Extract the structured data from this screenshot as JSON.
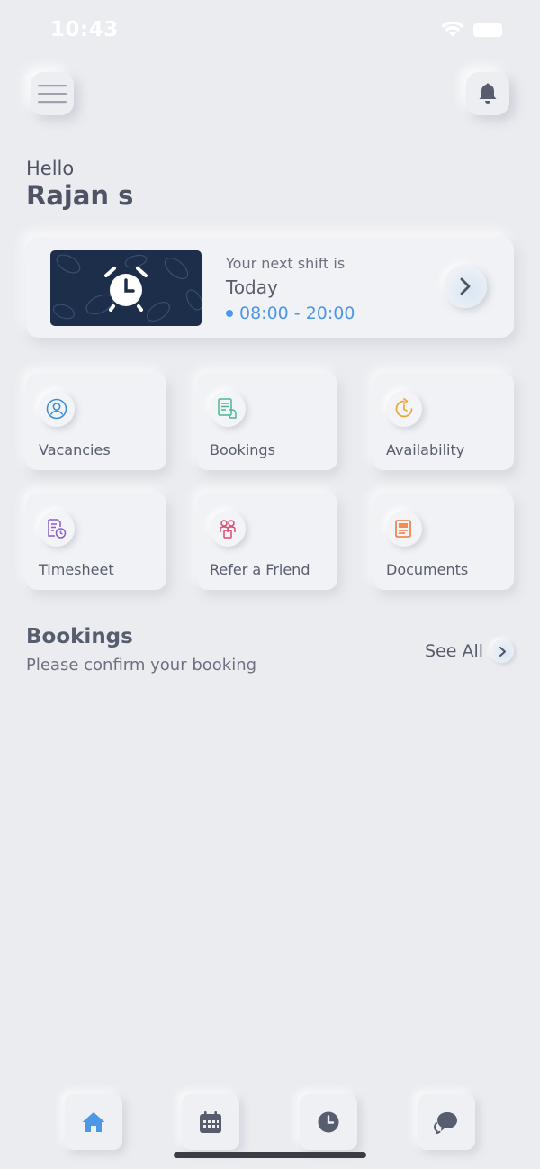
{
  "status_bar": {
    "time": "10:43"
  },
  "greeting": {
    "hello": "Hello",
    "name": "Rajan s"
  },
  "next_shift": {
    "label": "Your next shift is",
    "day": "Today",
    "time": "08:00 - 20:00"
  },
  "tiles": [
    {
      "label": "Vacancies",
      "icon": "user-circle-icon",
      "color": "#3a8fd6"
    },
    {
      "label": "Bookings",
      "icon": "booking-doc-icon",
      "color": "#4ab894"
    },
    {
      "label": "Availability",
      "icon": "clock-refresh-icon",
      "color": "#e8a83a"
    },
    {
      "label": "Timesheet",
      "icon": "timesheet-icon",
      "color": "#8a5cc7"
    },
    {
      "label": "Refer a Friend",
      "icon": "people-icon",
      "color": "#e04a6e"
    },
    {
      "label": "Documents",
      "icon": "documents-icon",
      "color": "#ef7a3a"
    }
  ],
  "bookings_section": {
    "title": "Bookings",
    "subtitle": "Please confirm your booking",
    "see_all": "See All"
  },
  "colors": {
    "accent": "#4c97e8",
    "background": "#ebecf0",
    "text": "#575d6e"
  }
}
